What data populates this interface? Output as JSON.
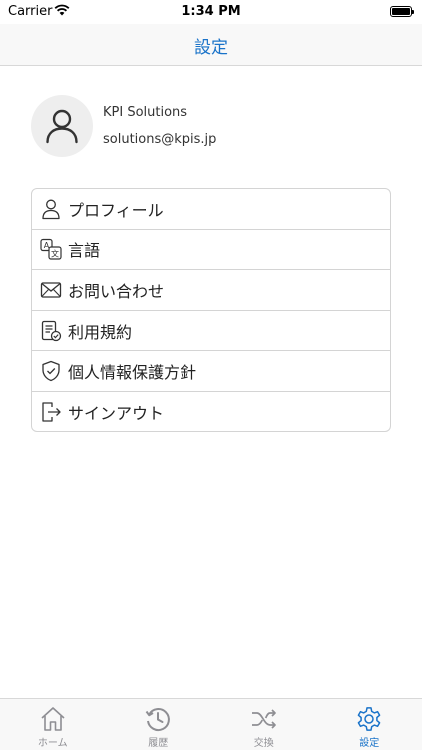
{
  "status_bar": {
    "carrier": "Carrier",
    "time": "1:34 PM"
  },
  "nav": {
    "title": "設定"
  },
  "profile": {
    "name": "KPI Solutions",
    "email": "solutions@kpis.jp",
    "avatar_icon": "person-icon"
  },
  "menu": [
    {
      "label": "プロフィール",
      "icon": "person-outline-icon"
    },
    {
      "label": "言語",
      "icon": "translate-icon"
    },
    {
      "label": "お問い合わせ",
      "icon": "envelope-icon"
    },
    {
      "label": "利用規約",
      "icon": "document-check-icon"
    },
    {
      "label": "個人情報保護方針",
      "icon": "shield-check-icon"
    },
    {
      "label": "サインアウト",
      "icon": "sign-out-icon"
    }
  ],
  "tabs": [
    {
      "label": "ホーム",
      "icon": "home-icon",
      "active": false
    },
    {
      "label": "履歴",
      "icon": "history-icon",
      "active": false
    },
    {
      "label": "交換",
      "icon": "shuffle-icon",
      "active": false
    },
    {
      "label": "設定",
      "icon": "gear-icon",
      "active": true
    }
  ],
  "colors": {
    "accent": "#1a73c9",
    "inactive": "#8e8e93",
    "border": "#d4d4d4"
  }
}
